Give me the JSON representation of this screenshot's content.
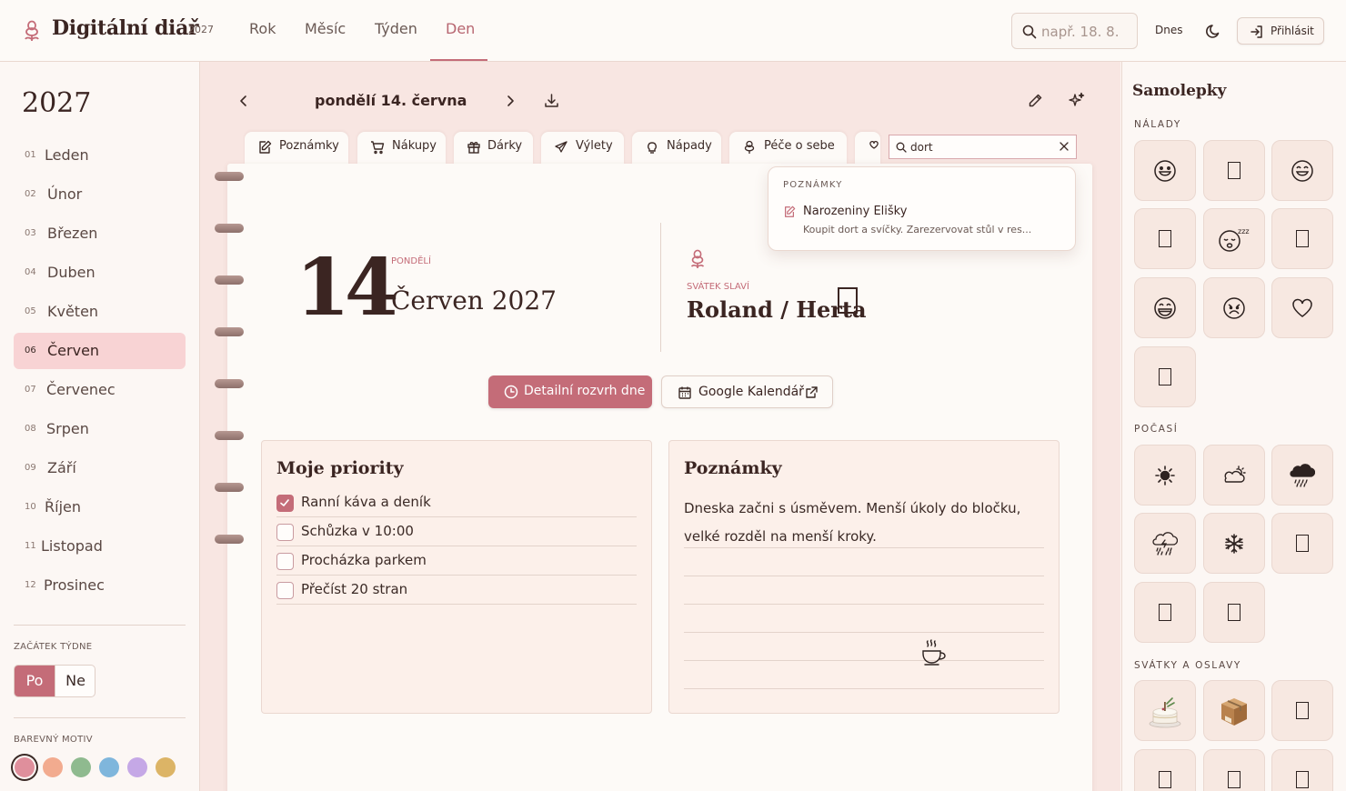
{
  "app": {
    "title": "Digitální diář",
    "year_badge": "2027"
  },
  "nav": {
    "items": [
      "Rok",
      "Měsíc",
      "Týden",
      "Den"
    ],
    "active": "Den"
  },
  "header": {
    "search_placeholder": "např. 18. 8.",
    "today_label": "Dnes",
    "login_label": "Přihlásit"
  },
  "sidebar": {
    "year": "2027",
    "months": [
      {
        "num": "01",
        "name": "Leden"
      },
      {
        "num": "02",
        "name": "Únor"
      },
      {
        "num": "03",
        "name": "Březen"
      },
      {
        "num": "04",
        "name": "Duben"
      },
      {
        "num": "05",
        "name": "Květen"
      },
      {
        "num": "06",
        "name": "Červen"
      },
      {
        "num": "07",
        "name": "Červenec"
      },
      {
        "num": "08",
        "name": "Srpen"
      },
      {
        "num": "09",
        "name": "Září"
      },
      {
        "num": "10",
        "name": "Říjen"
      },
      {
        "num": "11",
        "name": "Listopad"
      },
      {
        "num": "12",
        "name": "Prosinec"
      }
    ],
    "active_month": "Červen",
    "week_start_label": "ZAČÁTEK TÝDNE",
    "week_start_options": [
      "Po",
      "Ne"
    ],
    "week_start_selected": "Po",
    "theme_label": "BAREVNÝ MOTIV",
    "theme_colors": [
      "#df8f9c",
      "#f2ab8f",
      "#8fba8f",
      "#7fb6dc",
      "#c5a8e6",
      "#dcb466"
    ],
    "theme_selected": "#df8f9c"
  },
  "day": {
    "title": "pondělí 14. června",
    "tabs": [
      "Poznámky",
      "Nákupy",
      "Dárky",
      "Výlety",
      "Nápady",
      "Péče o sebe"
    ],
    "tab_search_value": "dort",
    "search_result": {
      "section": "POZNÁMKY",
      "title": "Narozeniny Elišky",
      "snippet": "Koupit dort a svíčky. Zarezervovat stůl v res..."
    },
    "day_number": "14",
    "weekday": "PONDĚLÍ",
    "month_year": "Červen 2027",
    "nameday_label": "SVÁTEK SLAVÍ",
    "nameday": "Roland / Herta",
    "detail_button": "Detailní rozvrh dne",
    "gcal_button": "Google Kalendář",
    "priorities_title": "Moje priority",
    "priorities": [
      {
        "text": "Ranní káva a deník",
        "done": true
      },
      {
        "text": "Schůzka v 10:00",
        "done": false
      },
      {
        "text": "Procházka parkem",
        "done": false
      },
      {
        "text": "Přečíst 20 stran",
        "done": false
      }
    ],
    "notes_title": "Poznámky",
    "notes_text": "Dneska začni s úsměvem. Menší úkoly do bločku, velké rozděl na menší kroky."
  },
  "stickers": {
    "title": "Samolepky",
    "sections": [
      {
        "label": "NÁLADY",
        "items": [
          "smile-icon",
          "missing-glyph",
          "smile-icon",
          "missing-glyph",
          "sleepy-icon",
          "missing-glyph",
          "grin-icon",
          "worried-icon",
          "heart-icon",
          "missing-glyph"
        ]
      },
      {
        "label": "POČASÍ",
        "items": [
          "sun-icon",
          "partly-cloudy-icon",
          "rain-cloud-icon",
          "storm-icon",
          "snowflake-icon",
          "missing-glyph",
          "missing-glyph",
          "missing-glyph"
        ]
      },
      {
        "label": "SVÁTKY A OSLAVY",
        "items": [
          "cake-icon",
          "gift-box-icon",
          "missing-glyph",
          "missing-glyph",
          "missing-glyph",
          "missing-glyph"
        ]
      }
    ]
  }
}
